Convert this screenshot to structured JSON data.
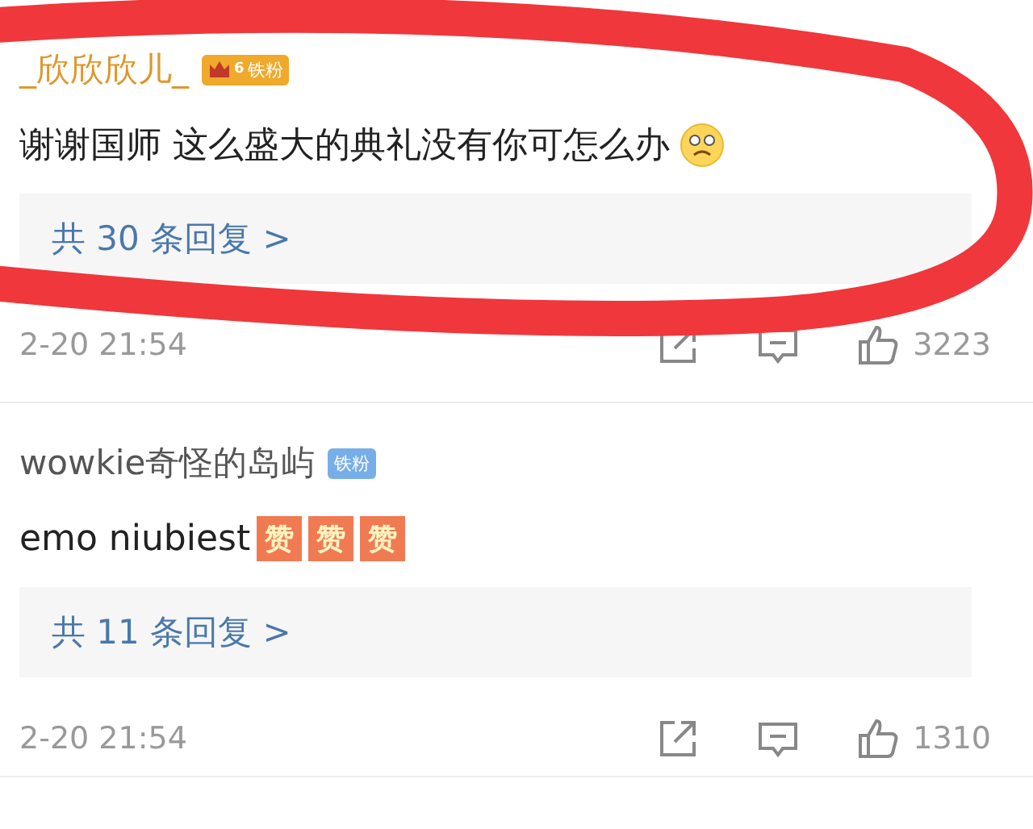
{
  "comments": [
    {
      "author": "_欣欣欣儿_",
      "kind": "gold",
      "badge": {
        "kind": "crown",
        "number": "6",
        "label": "铁粉"
      },
      "text": "谢谢国师 这么盛大的典礼没有你可怎么办",
      "emojis": [
        {
          "kind": "sad-face"
        }
      ],
      "replies": "共 30 条回复 >",
      "time": "2-20 21:54",
      "likes": "3223"
    },
    {
      "author": "wowkie奇怪的岛屿",
      "kind": "plain",
      "badge": {
        "kind": "plain",
        "label": "铁粉"
      },
      "text": "emo niubiest",
      "emojis": [
        {
          "kind": "sticker",
          "label": "赞"
        },
        {
          "kind": "sticker",
          "label": "赞"
        },
        {
          "kind": "sticker",
          "label": "赞"
        }
      ],
      "replies": "共 11 条回复 >",
      "time": "2-20 21:54",
      "likes": "1310"
    }
  ],
  "annotation": {
    "kind": "ellipse",
    "color": "#f0373c"
  }
}
